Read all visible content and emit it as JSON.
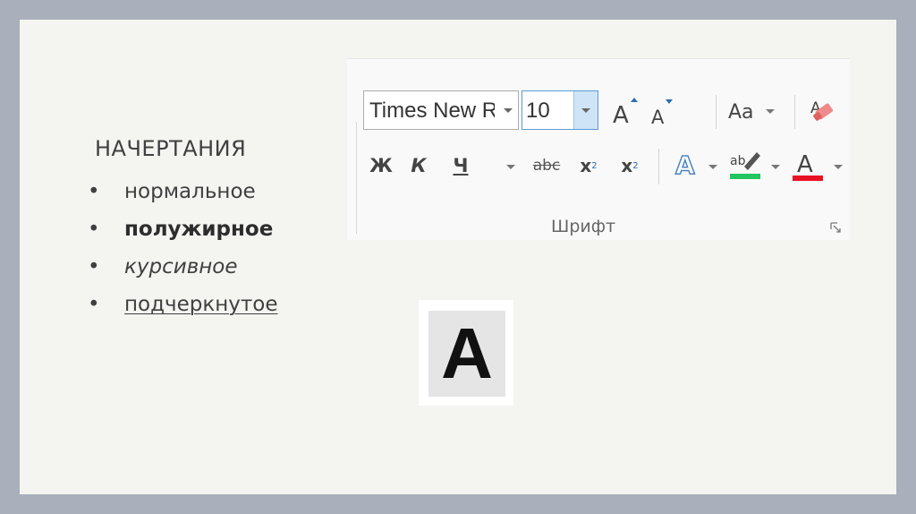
{
  "slide": {
    "heading": "НАЧЕРТАНИЯ",
    "bullet": "•",
    "items": [
      {
        "label": "нормальное",
        "style": "normal"
      },
      {
        "label": "полужирное",
        "style": "bold"
      },
      {
        "label": "курсивное",
        "style": "italic"
      },
      {
        "label": "подчеркнутое",
        "style": "underline"
      }
    ],
    "big_letter": "A"
  },
  "ribbon": {
    "group_label": "Шрифт",
    "font_name": "Times New R",
    "font_size": "10",
    "grow_font": {
      "letter": "A",
      "icon": "grow-font-icon"
    },
    "shrink_font": {
      "letter": "A",
      "icon": "shrink-font-icon"
    },
    "change_case": {
      "label": "Aa",
      "icon": "change-case-icon"
    },
    "clear_format": {
      "letter": "A",
      "icon": "eraser-icon"
    },
    "bold": "Ж",
    "italic": "К",
    "underline": "Ч",
    "strike": "abc",
    "subscript": {
      "base": "x",
      "mark": "2"
    },
    "superscript": {
      "base": "x",
      "mark": "2"
    },
    "text_effects": {
      "letter": "A",
      "icon": "text-effects-icon"
    },
    "highlight": {
      "label": "ab",
      "color": "#22c55e",
      "icon": "highlighter-icon"
    },
    "font_color": {
      "letter": "A",
      "color": "#e81123",
      "icon": "font-color-icon"
    }
  }
}
